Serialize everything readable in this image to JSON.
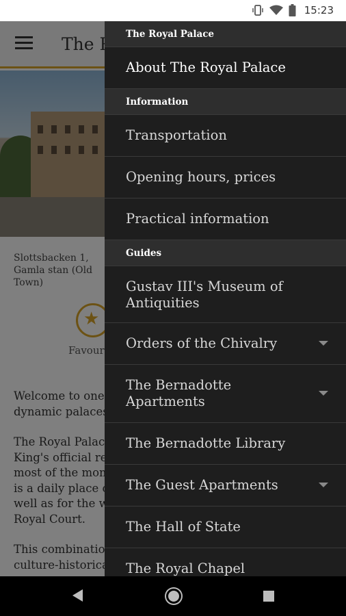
{
  "status_bar": {
    "time": "15:23",
    "icons": [
      "vibrate-icon",
      "wifi-icon",
      "battery-icon"
    ]
  },
  "app": {
    "title": "The Royal Palace",
    "address": "Slottsbacken 1, Gamla stan (Old Town)",
    "favourite_label": "Favourite",
    "paragraphs": [
      [
        "Welcome to one of Europe's most",
        "dynamic palaces"
      ],
      [
        "The Royal Palace is the",
        "King's official residence",
        "most of the monarchy's",
        "is a daily place of work",
        "well as for the work of the",
        "Royal Court."
      ],
      [
        "This combination of",
        "culture-historical"
      ]
    ],
    "accent_color": "#d9a429"
  },
  "drawer": {
    "sections": [
      {
        "header": "The Royal Palace",
        "items": [
          {
            "label": "About The Royal Palace",
            "expandable": false,
            "active": true
          }
        ]
      },
      {
        "header": "Information",
        "items": [
          {
            "label": "Transportation",
            "expandable": false
          },
          {
            "label": "Opening hours, prices",
            "expandable": false
          },
          {
            "label": "Practical information",
            "expandable": false
          }
        ]
      },
      {
        "header": "Guides",
        "items": [
          {
            "label": "Gustav III's Museum of Antiquities",
            "expandable": false
          },
          {
            "label": "Orders of the Chivalry",
            "expandable": true
          },
          {
            "label": "The Bernadotte Apartments",
            "expandable": true
          },
          {
            "label": "The Bernadotte Library",
            "expandable": false
          },
          {
            "label": "The Guest Apartments",
            "expandable": true
          },
          {
            "label": "The Hall of State",
            "expandable": false
          },
          {
            "label": "The Royal Chapel",
            "expandable": false
          }
        ]
      }
    ]
  },
  "nav_bar": {
    "icons": [
      "back-icon",
      "home-icon",
      "recents-icon"
    ]
  }
}
